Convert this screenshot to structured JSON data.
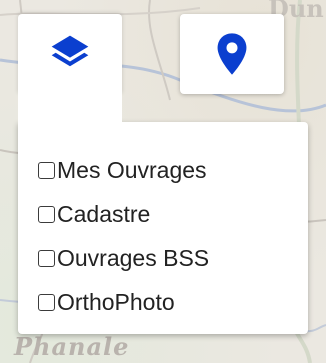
{
  "colors": {
    "accent": "#0b3fcf",
    "panel_bg": "#ffffff",
    "text": "#222222"
  },
  "map": {
    "bottom_label": "Phanale",
    "top_label": "Dun"
  },
  "controls": {
    "layers_button": {
      "icon": "layers-icon"
    },
    "location_button": {
      "icon": "map-marker-icon"
    }
  },
  "layers_menu": {
    "items": [
      {
        "label": "Mes Ouvrages",
        "checked": false
      },
      {
        "label": "Cadastre",
        "checked": false
      },
      {
        "label": "Ouvrages BSS",
        "checked": false
      },
      {
        "label": "OrthoPhoto",
        "checked": false
      }
    ]
  }
}
